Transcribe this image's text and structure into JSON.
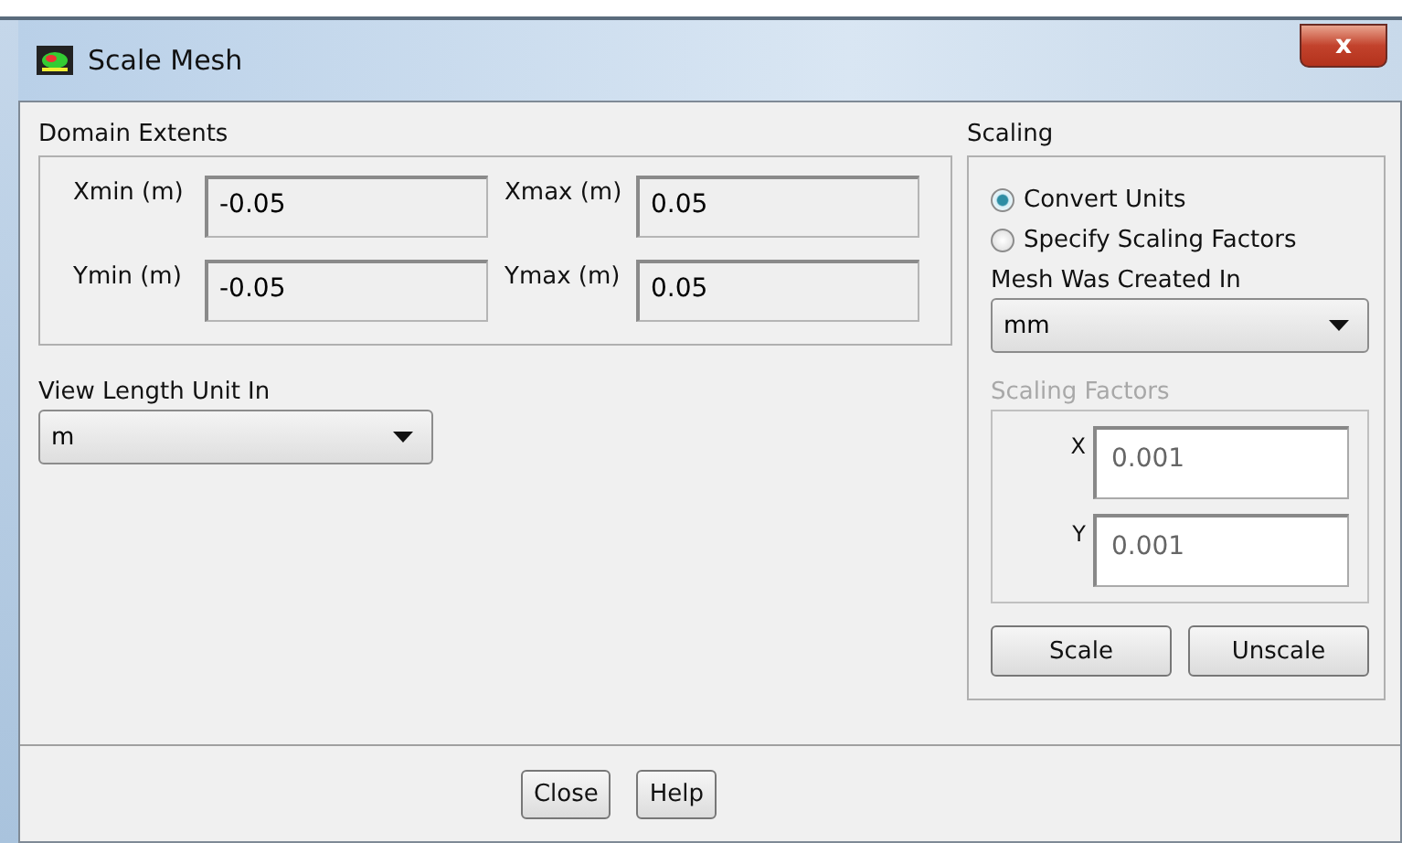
{
  "window": {
    "title": "Scale Mesh",
    "close": "x"
  },
  "domain_extents": {
    "label": "Domain Extents",
    "fields": [
      {
        "label": "Xmin (m)",
        "value": "-0.05"
      },
      {
        "label": "Xmax (m)",
        "value": "0.05"
      },
      {
        "label": "Ymin (m)",
        "value": "-0.05"
      },
      {
        "label": "Ymax (m)",
        "value": "0.05"
      }
    ]
  },
  "view_length_unit": {
    "label": "View Length Unit In",
    "value": "m"
  },
  "scaling": {
    "label": "Scaling",
    "options": [
      {
        "label": "Convert Units",
        "selected": true
      },
      {
        "label": "Specify Scaling Factors",
        "selected": false
      }
    ],
    "mesh_created_in": {
      "label": "Mesh Was Created In",
      "value": "mm"
    },
    "scaling_factors": {
      "label": "Scaling Factors",
      "disabled": true,
      "fields": [
        {
          "label": "X",
          "value": "0.001"
        },
        {
          "label": "Y",
          "value": "0.001"
        }
      ]
    },
    "buttons": [
      "Scale",
      "Unscale"
    ]
  },
  "buttons": [
    "Close",
    "Help"
  ]
}
